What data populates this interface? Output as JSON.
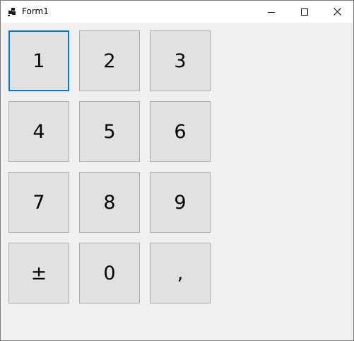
{
  "window": {
    "title": "Form1",
    "icon": "winforms-app-icon",
    "controls": {
      "minimize": "minimize-icon",
      "maximize": "maximize-icon",
      "close": "close-icon"
    }
  },
  "keypad": {
    "keys": [
      "1",
      "2",
      "3",
      "4",
      "5",
      "6",
      "7",
      "8",
      "9",
      "±",
      "0",
      ","
    ],
    "focused_key": "1"
  },
  "colors": {
    "focus_border": "#0078d7",
    "button_face": "#e1e1e1",
    "window_background": "#f0f0f0"
  }
}
